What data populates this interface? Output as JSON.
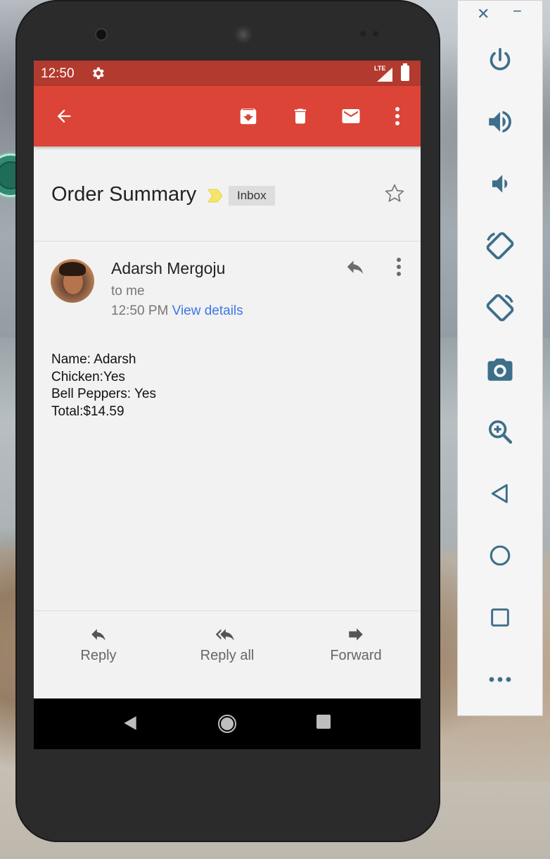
{
  "statusbar": {
    "time": "12:50",
    "network": "LTE"
  },
  "toolbar": {
    "back_icon": "arrow-back-icon",
    "archive_icon": "archive-icon",
    "delete_icon": "trash-icon",
    "mark_unread_icon": "mail-icon",
    "more_icon": "more-vert-icon"
  },
  "email": {
    "subject": "Order Summary",
    "label": "Inbox",
    "sender": "Adarsh Mergoju",
    "recipient": "to me",
    "time": "12:50 PM",
    "view_details": "View details",
    "body_lines": [
      "Name: Adarsh",
      "Chicken:Yes",
      "Bell Peppers: Yes",
      "Total:$14.59"
    ]
  },
  "footer": {
    "reply": "Reply",
    "reply_all": "Reply all",
    "forward": "Forward"
  },
  "side_panel": {
    "close": "✕",
    "minimize": "−",
    "buttons": [
      "power-icon",
      "volume-up-icon",
      "volume-down-icon",
      "rotate-left-icon",
      "rotate-right-icon",
      "camera-icon",
      "zoom-icon",
      "back-icon",
      "home-icon",
      "overview-icon",
      "more-icon"
    ]
  },
  "colors": {
    "statusbar": "#b33a2e",
    "toolbar": "#db4437",
    "link": "#3b78e7",
    "side_icon": "#3e6f8a"
  }
}
